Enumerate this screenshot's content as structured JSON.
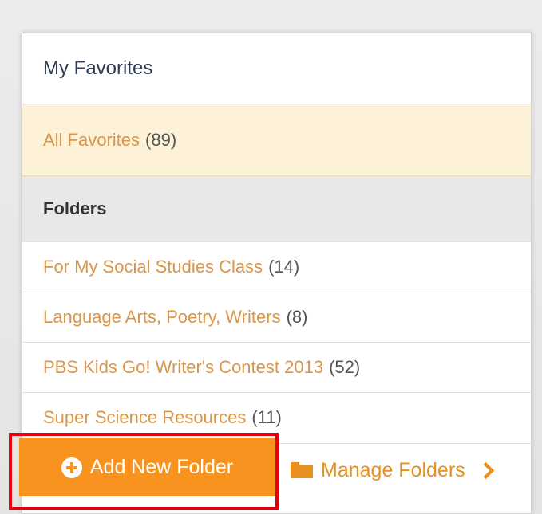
{
  "panel": {
    "title": "My Favorites",
    "all_favorites": {
      "label": "All Favorites",
      "count": "(89)"
    },
    "folders_heading": "Folders",
    "folders": [
      {
        "label": "For My Social Studies Class",
        "count": "(14)"
      },
      {
        "label": "Language Arts, Poetry, Writers",
        "count": "(8)"
      },
      {
        "label": "PBS Kids Go! Writer's Contest 2013",
        "count": "(52)"
      },
      {
        "label": "Super Science Resources",
        "count": "(11)"
      }
    ]
  },
  "actions": {
    "add_new_folder": "Add New Folder",
    "manage_folders": "Manage Folders"
  },
  "icons": {
    "add": "plus-circle-icon",
    "manage": "folder-icon",
    "chevron": "chevron-right-icon"
  },
  "colors": {
    "accent": "#f7931e",
    "link": "#d9964a",
    "highlight_outline": "#e3000f",
    "selected_row_bg": "#fdf1d8"
  }
}
